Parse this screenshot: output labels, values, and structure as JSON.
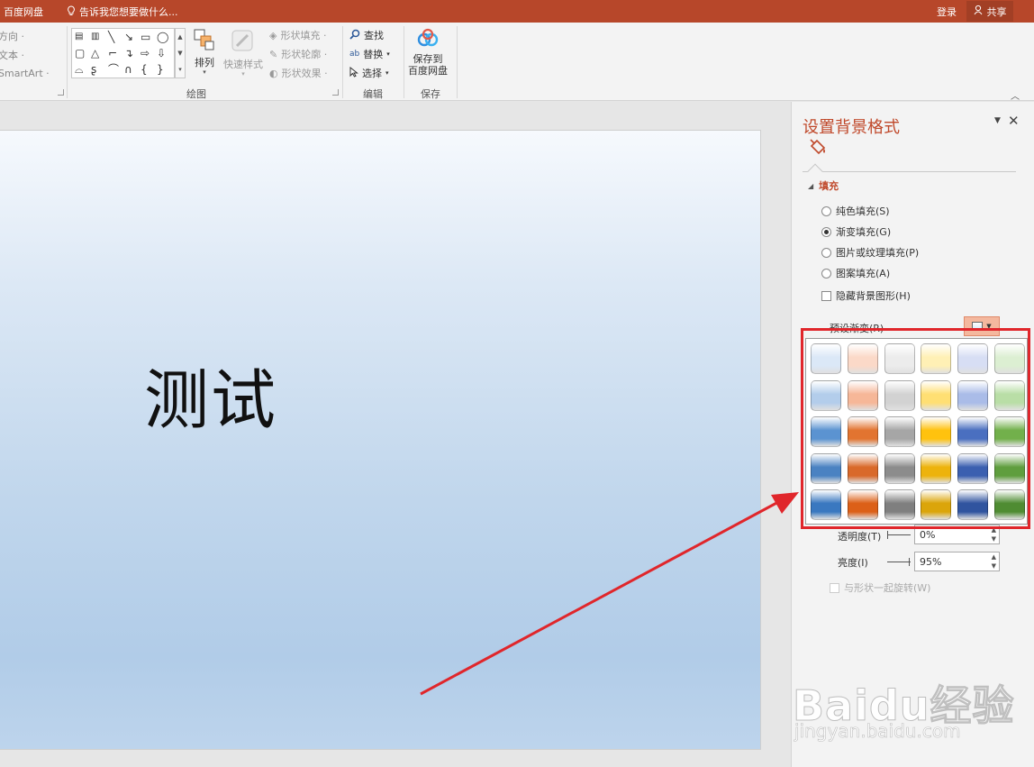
{
  "titlebar": {
    "app_name": "百度网盘",
    "tell_me": "告诉我您想要做什么...",
    "login": "登录",
    "share": "共享"
  },
  "ribbon": {
    "left_items": [
      "方向 ·",
      "文本 ·",
      "SmartArt ·"
    ],
    "arrange_label": "排列",
    "quick_styles_label": "快速样式",
    "shape_fill": "形状填充 ·",
    "shape_outline": "形状轮廓 ·",
    "shape_effects": "形状效果 ·",
    "drawing_group": "绘图",
    "find": "查找",
    "replace": "替换",
    "select": "选择",
    "editing_group": "编辑",
    "save_label_1": "保存到",
    "save_label_2": "百度网盘",
    "save_group": "保存"
  },
  "slide": {
    "text": "测试",
    "background_gradient_colors": [
      "#f6f9fd",
      "#dce8f5",
      "#c0d6ec",
      "#b1cce8",
      "#bdd4ec"
    ]
  },
  "pane": {
    "title": "设置背景格式",
    "section": "填充",
    "options": [
      {
        "label": "纯色填充(S)",
        "checked": false
      },
      {
        "label": "渐变填充(G)",
        "checked": true
      },
      {
        "label": "图片或纹理填充(P)",
        "checked": false
      },
      {
        "label": "图案填充(A)",
        "checked": false
      }
    ],
    "hide_bg_graphics": "隐藏背景图形(H)",
    "preset_label": "预设渐变(R)",
    "transparency_label": "透明度(T)",
    "transparency_value": "0%",
    "brightness_label": "亮度(I)",
    "brightness_value": "95%",
    "rotate_with_shape": "与形状一起旋转(W)"
  },
  "preset_gradients": {
    "columns": [
      "blue",
      "orange",
      "gray",
      "gold",
      "indigo",
      "green"
    ],
    "rows": [
      [
        "#dbe8f7",
        "#fbd9c8",
        "#ececec",
        "#fff0b5",
        "#d7def4",
        "#dcefd2"
      ],
      [
        "#b3cdeb",
        "#f6b798",
        "#d2d2d2",
        "#ffdf73",
        "#aabce8",
        "#b9dea6"
      ],
      [
        "#5b93d1",
        "#e27430",
        "#a6a6a6",
        "#ffc20e",
        "#4a6fc0",
        "#72b04b"
      ],
      [
        "#4a82c2",
        "#d9692a",
        "#8c8c8c",
        "#edb30c",
        "#3b5fb0",
        "#5f9e3e"
      ],
      [
        "#3a78c0",
        "#dc6018",
        "#7f7f7f",
        "#dba50a",
        "#30549f",
        "#4f8c32"
      ]
    ]
  },
  "accent_colors": {
    "titlebar": "#b7472a",
    "pane_title": "#c0492b",
    "highlight_box": "#e0262b",
    "arrow": "#e0262b"
  },
  "watermark": {
    "main": "Baidu经验",
    "sub": "jingyan.baidu.com"
  }
}
